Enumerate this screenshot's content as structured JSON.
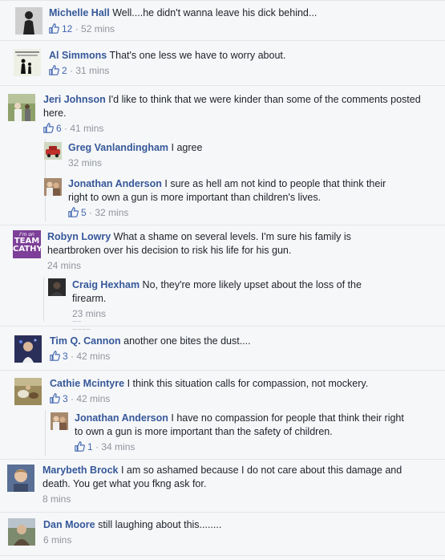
{
  "comments": [
    {
      "name": "Michelle Hall",
      "text": "Well....he didn't wanna leave his dick behind...",
      "likes": "12",
      "time": "52 mins",
      "avatar": "person-silhouette-icon"
    },
    {
      "name": "Al Simmons",
      "text": "That's one less we have to worry about.",
      "likes": "2",
      "time": "31 mins",
      "avatar": "poster-silhouette-icon"
    },
    {
      "name": "Jeri Johnson",
      "text": "I'd like to think that we were kinder than some of the comments posted here.",
      "likes": "6",
      "time": "41 mins",
      "avatar": "outdoor-photo-icon"
    },
    {
      "name": "Greg Vanlandingham",
      "text": "I agree",
      "time": "32 mins",
      "avatar": "car-photo-icon"
    },
    {
      "name": "Jonathan Anderson",
      "text": "I sure as hell am not kind to people that think their right to own a gun is more important than children's lives.",
      "likes": "5",
      "time": "32 mins",
      "avatar": "couple-photo-icon"
    },
    {
      "name": "Robyn Lowry",
      "text": "What a shame on several levels. I'm sure his family is heartbroken over his decision to risk his life for his gun.",
      "time": "24 mins",
      "avatar": "team-cathy-badge",
      "badge": {
        "line1": "I'm on",
        "line2": "TEAM",
        "line3": "CATHY"
      }
    },
    {
      "name": "Craig Hexham",
      "text": "No, they're more likely upset about the loss of the firearm.",
      "time": "23 mins",
      "avatar": "dark-portrait-icon"
    },
    {
      "name": "Tim Q. Cannon",
      "text": "another one bites the dust....",
      "likes": "3",
      "time": "42 mins",
      "avatar": "night-portrait-icon"
    },
    {
      "name": "Cathie Mcintyre",
      "text": "I think this situation calls for compassion, not mockery.",
      "likes": "3",
      "time": "42 mins",
      "avatar": "animals-photo-icon"
    },
    {
      "name": "Jonathan Anderson",
      "text": "I have no compassion for people that think their right to own a gun is more important than the safety of children.",
      "likes": "1",
      "time": "34 mins",
      "avatar": "couple-photo-icon"
    },
    {
      "name": "Marybeth Brock",
      "text": "I am so ashamed because I do not care about this damage and death. You get what you fkng ask for.",
      "time": "8 mins",
      "avatar": "child-portrait-icon"
    },
    {
      "name": "Dan Moore",
      "text": "still laughing about this........",
      "time": "6 mins",
      "avatar": "outdoor-portrait-icon"
    }
  ],
  "colors": {
    "name": "#365899",
    "like": "#4267b2",
    "meta": "#90949c",
    "text": "#1d2129",
    "bg": "#f6f7f9"
  }
}
